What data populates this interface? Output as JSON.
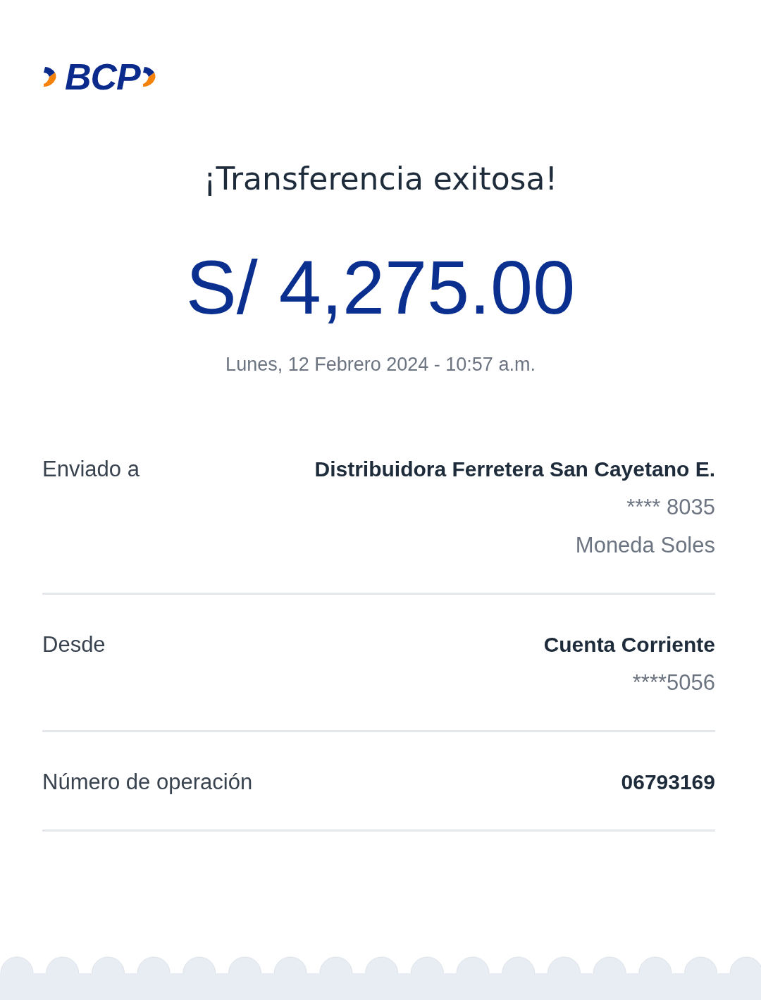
{
  "logo": {
    "text": "BCP"
  },
  "title": "¡Transferencia exitosa!",
  "amount": "S/ 4,275.00",
  "datetime": "Lunes, 12 Febrero 2024 - 10:57 a.m.",
  "details": [
    {
      "label": "Enviado a",
      "values": [
        {
          "kind": "primary",
          "text": "Distribuidora Ferretera San Cayetano E."
        },
        {
          "kind": "secondary",
          "text": "**** 8035"
        },
        {
          "kind": "secondary",
          "text": "Moneda Soles"
        }
      ]
    },
    {
      "label": "Desde",
      "values": [
        {
          "kind": "primary",
          "text": "Cuenta Corriente"
        },
        {
          "kind": "secondary",
          "text": "****5056"
        }
      ]
    },
    {
      "label": "Número de operación",
      "values": [
        {
          "kind": "primary",
          "text": "06793169"
        }
      ]
    }
  ]
}
